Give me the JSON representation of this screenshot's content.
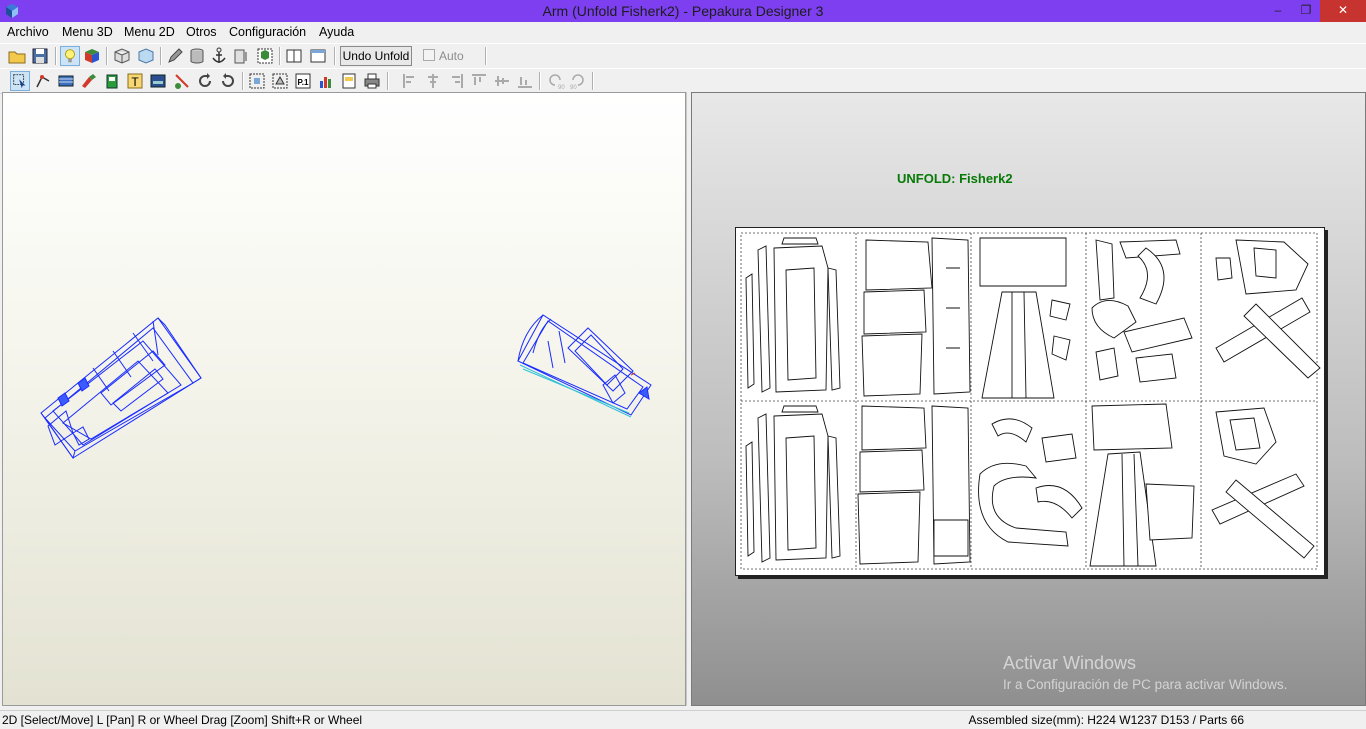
{
  "window": {
    "title": "Arm (Unfold Fisherk2) - Pepakura Designer 3"
  },
  "menu": [
    "Archivo",
    "Menu 3D",
    "Menu 2D",
    "Otros",
    "Configuración",
    "Ayuda"
  ],
  "toolbar1": {
    "undo_unfold_label": "Undo Unfold",
    "auto_label": "Auto",
    "auto_checked": false
  },
  "view2d": {
    "unfold_title": "UNFOLD: Fisherk2"
  },
  "watermark": {
    "line1": "Activar Windows",
    "line2": "Ir a Configuración de PC para activar Windows."
  },
  "status": {
    "left": "2D [Select/Move] L [Pan] R or Wheel Drag [Zoom] Shift+R or Wheel",
    "right": "Assembled size(mm): H224 W1237 D153 / Parts 66"
  },
  "colors": {
    "titlebar": "#7d3ff0",
    "unfold_title": "#087a08",
    "wireframe": "#1a2cff",
    "close_button": "#c7332f"
  }
}
